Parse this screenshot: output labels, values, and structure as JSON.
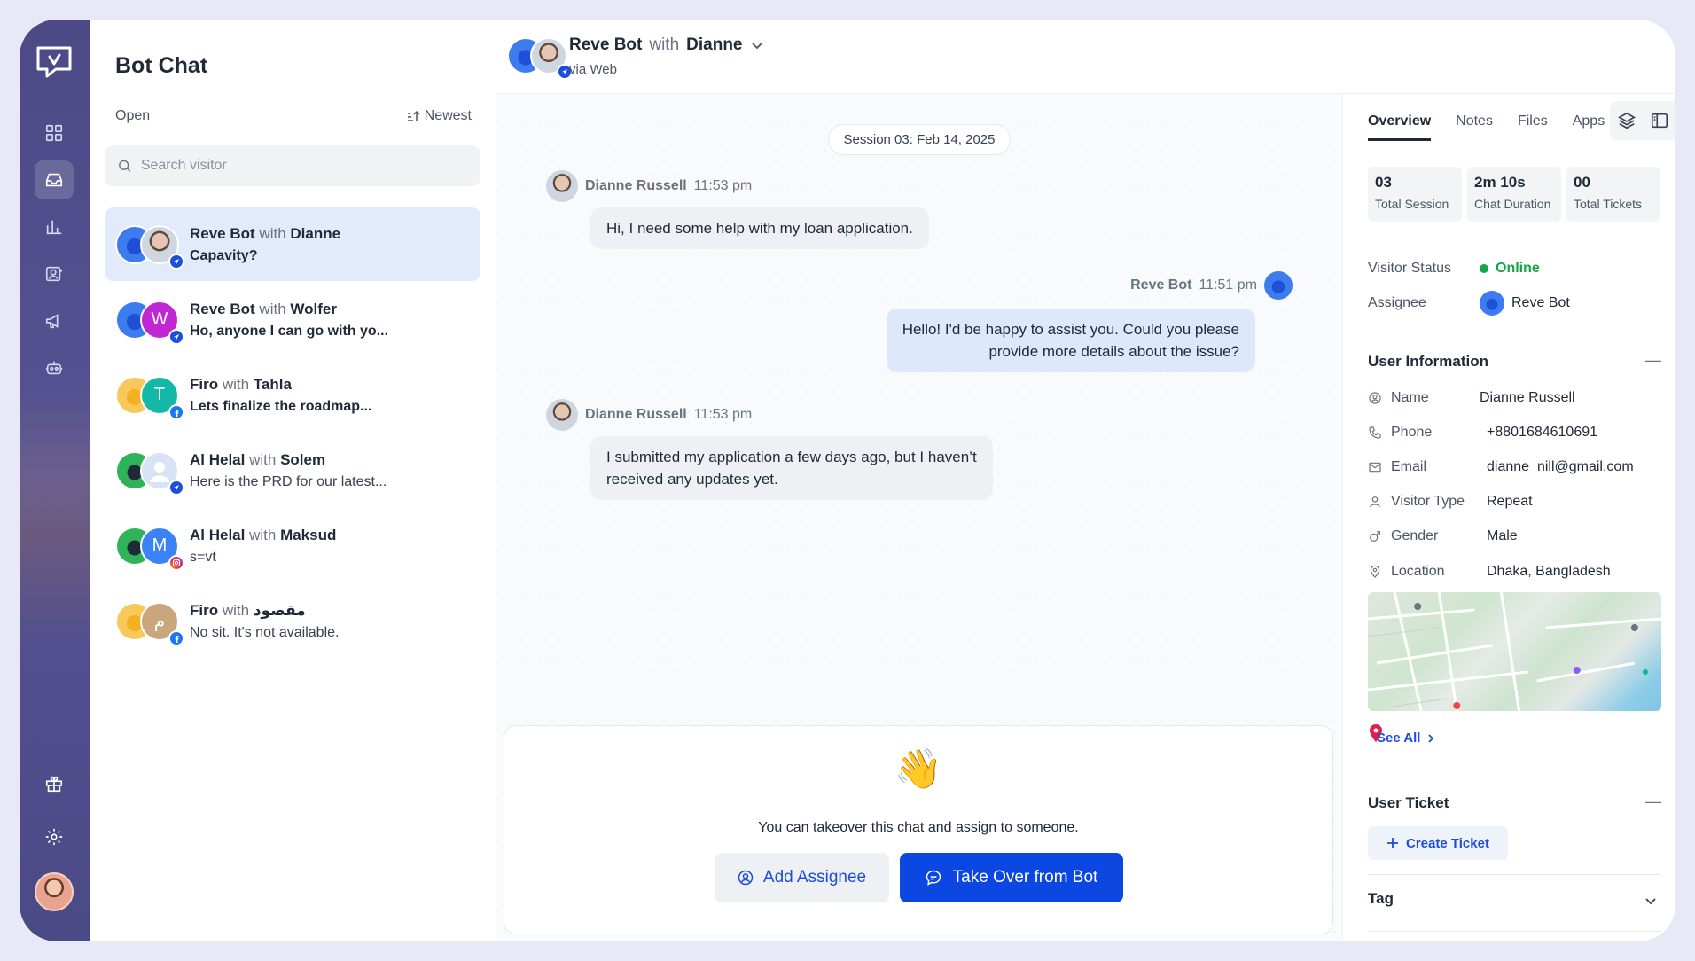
{
  "sidebar": {
    "items": [
      {
        "icon": "grid-icon"
      },
      {
        "icon": "inbox-icon",
        "active": true
      },
      {
        "icon": "bar-chart-icon"
      },
      {
        "icon": "contacts-icon"
      },
      {
        "icon": "megaphone-icon"
      },
      {
        "icon": "bot-icon"
      }
    ],
    "bottom": [
      {
        "icon": "gift-icon"
      },
      {
        "icon": "gear-icon"
      }
    ]
  },
  "list": {
    "title": "Bot Chat",
    "status": "Open",
    "sort": "Newest",
    "search_placeholder": "Search visitor",
    "conversations": [
      {
        "agent": "Reve Bot",
        "with": "with",
        "visitor": "Dianne",
        "preview": "Capavity?",
        "letter": "",
        "channel": "web",
        "active": true
      },
      {
        "agent": "Reve Bot",
        "with": "with",
        "visitor": "Wolfer",
        "preview": "Ho, anyone I can go with yo...",
        "letter": "W",
        "channel": "web"
      },
      {
        "agent": "Firo",
        "with": "with",
        "visitor": "Tahla",
        "preview": "Lets finalize the roadmap...",
        "letter": "T",
        "channel": "facebook"
      },
      {
        "agent": "Al  Helal",
        "with": "with",
        "visitor": "Solem",
        "preview": "Here is the PRD for our latest...",
        "letter": "",
        "channel": "web"
      },
      {
        "agent": "Al  Helal",
        "with": "with",
        "visitor": "Maksud",
        "preview": "s=vt",
        "letter": "M",
        "channel": "instagram"
      },
      {
        "agent": "Firo",
        "with": "with",
        "visitor": "مقصود",
        "preview": "No sit. It's not available.",
        "letter": "م",
        "channel": "facebook"
      }
    ]
  },
  "chat": {
    "header": {
      "agent": "Reve Bot",
      "with": "with",
      "visitor": "Dianne",
      "via": "via Web"
    },
    "session": "Session 03: Feb 14, 2025",
    "messages": [
      {
        "sender": "Dianne Russell",
        "time": "11:53 pm",
        "text": "Hi, I need some help with my loan application."
      },
      {
        "sender": "Reve Bot",
        "time": "11:51 pm",
        "text_line1": "Hello! I'd be happy to assist you. Could you please",
        "text_line2": "provide more details about the issue?"
      },
      {
        "sender": "Dianne Russell",
        "time": "11:53 pm",
        "text_line1": "I submitted my application a few days ago, but I haven’t",
        "text_line2": "received any updates yet."
      }
    ],
    "takeover": {
      "emoji": "👋",
      "message": "You can takeover this chat and assign to someone.",
      "assign_label": "Add Assignee",
      "takeover_label": "Take Over from Bot"
    }
  },
  "details": {
    "tabs": [
      "Overview",
      "Notes",
      "Files",
      "Apps"
    ],
    "stats": [
      {
        "value": "03",
        "label": "Total Session"
      },
      {
        "value": "2m 10s",
        "label": "Chat Duration"
      },
      {
        "value": "00",
        "label": "Total Tickets"
      }
    ],
    "visitor_status_label": "Visitor Status",
    "visitor_status": "Online",
    "assignee_label": "Assignee",
    "assignee": "Reve Bot",
    "user_info_title": "User Information",
    "user_info": [
      {
        "label": "Name",
        "value": "Dianne Russell",
        "icon": "user-circle-icon"
      },
      {
        "label": "Phone",
        "value": "+8801684610691",
        "icon": "phone-icon"
      },
      {
        "label": "Email",
        "value": "dianne_nill@gmail.com",
        "icon": "mail-icon"
      },
      {
        "label": "Visitor Type",
        "value": "Repeat",
        "icon": "user-icon"
      },
      {
        "label": "Gender",
        "value": "Male",
        "icon": "male-icon"
      },
      {
        "label": "Location",
        "value": "Dhaka, Bangladesh",
        "icon": "location-pin-icon"
      }
    ],
    "see_all": "See All",
    "ticket_title": "User Ticket",
    "create_ticket": "Create Ticket",
    "tag_title": "Tag",
    "collapse_glyph": "—"
  },
  "colors": {
    "primary": "#0b47e0",
    "online": "#16a34a",
    "rail": "#4b4a86",
    "active_bg": "#e2ebfb"
  }
}
